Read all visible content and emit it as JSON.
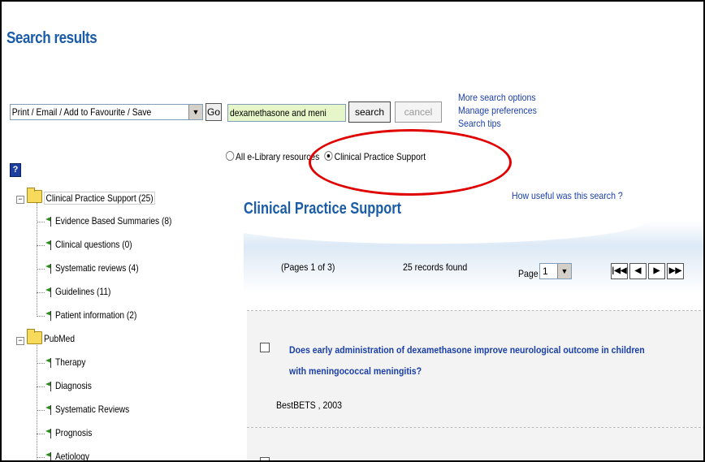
{
  "header": {
    "title": "Search results"
  },
  "toolbar": {
    "action_select_value": "Print / Email / Add to Favourite / Save",
    "go_label": "Go",
    "search_value": "dexamethasone and meni",
    "search_label": "search",
    "cancel_label": "cancel"
  },
  "links": {
    "more_options": "More search options",
    "preferences": "Manage preferences",
    "tips": "Search tips"
  },
  "scope": {
    "option_all": "All e-Library resources",
    "option_csp": "Clinical Practice Support",
    "selected": "Clinical Practice Support"
  },
  "help_icon_label": "?",
  "tree": {
    "folders": [
      {
        "label": "Clinical Practice Support (25)",
        "children": [
          "Evidence Based Summaries (8)",
          "Clinical questions (0)",
          "Systematic reviews (4)",
          "Guidelines (11)",
          "Patient information (2)"
        ]
      },
      {
        "label": "PubMed",
        "children": [
          "Therapy",
          "Diagnosis",
          "Systematic Reviews",
          "Prognosis",
          "Aetiology"
        ]
      }
    ]
  },
  "results": {
    "heading": "Clinical Practice Support",
    "useful_link": "How useful was this search ?",
    "pages_text": "(Pages 1 of 3)",
    "found_text": "25 records found",
    "page_label": "Page",
    "page_value": "1",
    "nav": {
      "first": "⏮",
      "prev": "◀",
      "next": "▶",
      "last": "⏭"
    },
    "records": [
      {
        "title": "Does early administration of dexamethasone improve neurological outcome in children with meningococcal meningitis?",
        "source": "BestBETS , 2003"
      }
    ]
  },
  "annotation_color": "#e00000",
  "accent_color": "#1a5ca8"
}
